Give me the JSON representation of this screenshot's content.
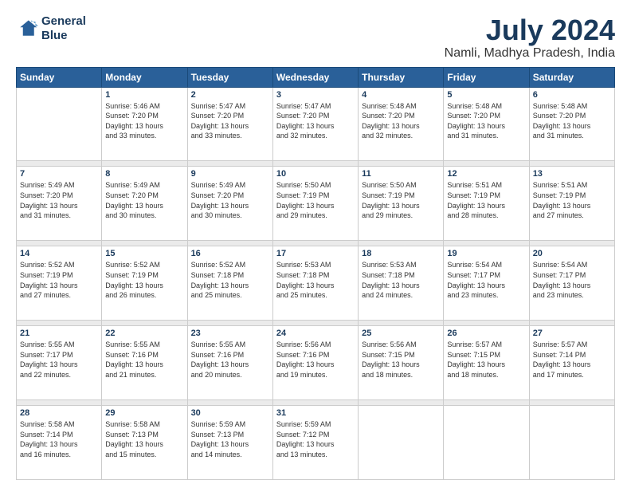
{
  "header": {
    "logo_line1": "General",
    "logo_line2": "Blue",
    "title": "July 2024",
    "subtitle": "Namli, Madhya Pradesh, India"
  },
  "days_of_week": [
    "Sunday",
    "Monday",
    "Tuesday",
    "Wednesday",
    "Thursday",
    "Friday",
    "Saturday"
  ],
  "weeks": [
    [
      {
        "day": "",
        "info": ""
      },
      {
        "day": "1",
        "info": "Sunrise: 5:46 AM\nSunset: 7:20 PM\nDaylight: 13 hours\nand 33 minutes."
      },
      {
        "day": "2",
        "info": "Sunrise: 5:47 AM\nSunset: 7:20 PM\nDaylight: 13 hours\nand 33 minutes."
      },
      {
        "day": "3",
        "info": "Sunrise: 5:47 AM\nSunset: 7:20 PM\nDaylight: 13 hours\nand 32 minutes."
      },
      {
        "day": "4",
        "info": "Sunrise: 5:48 AM\nSunset: 7:20 PM\nDaylight: 13 hours\nand 32 minutes."
      },
      {
        "day": "5",
        "info": "Sunrise: 5:48 AM\nSunset: 7:20 PM\nDaylight: 13 hours\nand 31 minutes."
      },
      {
        "day": "6",
        "info": "Sunrise: 5:48 AM\nSunset: 7:20 PM\nDaylight: 13 hours\nand 31 minutes."
      }
    ],
    [
      {
        "day": "7",
        "info": "Sunrise: 5:49 AM\nSunset: 7:20 PM\nDaylight: 13 hours\nand 31 minutes."
      },
      {
        "day": "8",
        "info": "Sunrise: 5:49 AM\nSunset: 7:20 PM\nDaylight: 13 hours\nand 30 minutes."
      },
      {
        "day": "9",
        "info": "Sunrise: 5:49 AM\nSunset: 7:20 PM\nDaylight: 13 hours\nand 30 minutes."
      },
      {
        "day": "10",
        "info": "Sunrise: 5:50 AM\nSunset: 7:19 PM\nDaylight: 13 hours\nand 29 minutes."
      },
      {
        "day": "11",
        "info": "Sunrise: 5:50 AM\nSunset: 7:19 PM\nDaylight: 13 hours\nand 29 minutes."
      },
      {
        "day": "12",
        "info": "Sunrise: 5:51 AM\nSunset: 7:19 PM\nDaylight: 13 hours\nand 28 minutes."
      },
      {
        "day": "13",
        "info": "Sunrise: 5:51 AM\nSunset: 7:19 PM\nDaylight: 13 hours\nand 27 minutes."
      }
    ],
    [
      {
        "day": "14",
        "info": "Sunrise: 5:52 AM\nSunset: 7:19 PM\nDaylight: 13 hours\nand 27 minutes."
      },
      {
        "day": "15",
        "info": "Sunrise: 5:52 AM\nSunset: 7:19 PM\nDaylight: 13 hours\nand 26 minutes."
      },
      {
        "day": "16",
        "info": "Sunrise: 5:52 AM\nSunset: 7:18 PM\nDaylight: 13 hours\nand 25 minutes."
      },
      {
        "day": "17",
        "info": "Sunrise: 5:53 AM\nSunset: 7:18 PM\nDaylight: 13 hours\nand 25 minutes."
      },
      {
        "day": "18",
        "info": "Sunrise: 5:53 AM\nSunset: 7:18 PM\nDaylight: 13 hours\nand 24 minutes."
      },
      {
        "day": "19",
        "info": "Sunrise: 5:54 AM\nSunset: 7:17 PM\nDaylight: 13 hours\nand 23 minutes."
      },
      {
        "day": "20",
        "info": "Sunrise: 5:54 AM\nSunset: 7:17 PM\nDaylight: 13 hours\nand 23 minutes."
      }
    ],
    [
      {
        "day": "21",
        "info": "Sunrise: 5:55 AM\nSunset: 7:17 PM\nDaylight: 13 hours\nand 22 minutes."
      },
      {
        "day": "22",
        "info": "Sunrise: 5:55 AM\nSunset: 7:16 PM\nDaylight: 13 hours\nand 21 minutes."
      },
      {
        "day": "23",
        "info": "Sunrise: 5:55 AM\nSunset: 7:16 PM\nDaylight: 13 hours\nand 20 minutes."
      },
      {
        "day": "24",
        "info": "Sunrise: 5:56 AM\nSunset: 7:16 PM\nDaylight: 13 hours\nand 19 minutes."
      },
      {
        "day": "25",
        "info": "Sunrise: 5:56 AM\nSunset: 7:15 PM\nDaylight: 13 hours\nand 18 minutes."
      },
      {
        "day": "26",
        "info": "Sunrise: 5:57 AM\nSunset: 7:15 PM\nDaylight: 13 hours\nand 18 minutes."
      },
      {
        "day": "27",
        "info": "Sunrise: 5:57 AM\nSunset: 7:14 PM\nDaylight: 13 hours\nand 17 minutes."
      }
    ],
    [
      {
        "day": "28",
        "info": "Sunrise: 5:58 AM\nSunset: 7:14 PM\nDaylight: 13 hours\nand 16 minutes."
      },
      {
        "day": "29",
        "info": "Sunrise: 5:58 AM\nSunset: 7:13 PM\nDaylight: 13 hours\nand 15 minutes."
      },
      {
        "day": "30",
        "info": "Sunrise: 5:59 AM\nSunset: 7:13 PM\nDaylight: 13 hours\nand 14 minutes."
      },
      {
        "day": "31",
        "info": "Sunrise: 5:59 AM\nSunset: 7:12 PM\nDaylight: 13 hours\nand 13 minutes."
      },
      {
        "day": "",
        "info": ""
      },
      {
        "day": "",
        "info": ""
      },
      {
        "day": "",
        "info": ""
      }
    ]
  ]
}
